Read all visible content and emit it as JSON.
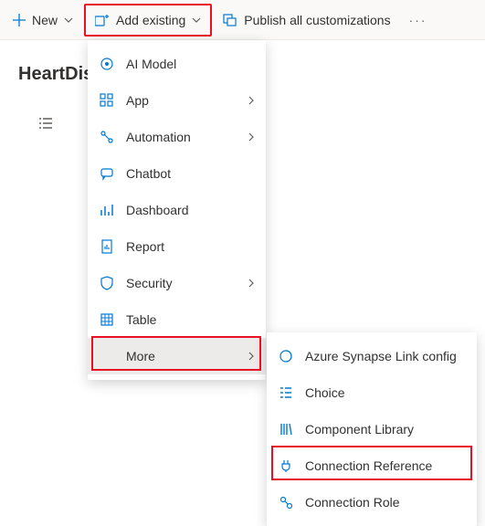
{
  "toolbar": {
    "new_label": "New",
    "add_existing_label": "Add existing",
    "publish_label": "Publish all customizations"
  },
  "page": {
    "title": "HeartDise"
  },
  "menu": {
    "items": [
      {
        "label": "AI Model",
        "has_submenu": false
      },
      {
        "label": "App",
        "has_submenu": true
      },
      {
        "label": "Automation",
        "has_submenu": true
      },
      {
        "label": "Chatbot",
        "has_submenu": false
      },
      {
        "label": "Dashboard",
        "has_submenu": false
      },
      {
        "label": "Report",
        "has_submenu": false
      },
      {
        "label": "Security",
        "has_submenu": true
      },
      {
        "label": "Table",
        "has_submenu": false
      },
      {
        "label": "More",
        "has_submenu": true
      }
    ]
  },
  "submenu": {
    "items": [
      {
        "label": "Azure Synapse Link config"
      },
      {
        "label": "Choice"
      },
      {
        "label": "Component Library"
      },
      {
        "label": "Connection Reference"
      },
      {
        "label": "Connection Role"
      }
    ]
  }
}
